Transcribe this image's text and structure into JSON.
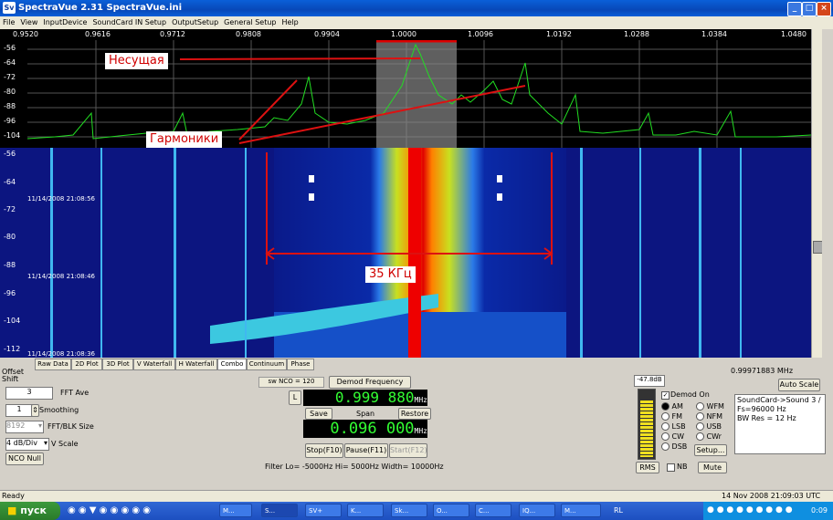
{
  "window": {
    "title": "SpectraVue 2.31 SpectraVue.ini",
    "app_icon": "Sv"
  },
  "menu": [
    "File",
    "View",
    "InputDevice",
    "SoundCard IN Setup",
    "OutputSetup",
    "General Setup",
    "Help"
  ],
  "freq_axis": [
    "0.9520",
    "0.9616",
    "0.9712",
    "0.9808",
    "0.9904",
    "1.0000",
    "1.0096",
    "1.0192",
    "1.0288",
    "1.0384",
    "1.0480"
  ],
  "spectrum_y": [
    "-56",
    "-64",
    "-72",
    "-80",
    "-88",
    "-96",
    "-104"
  ],
  "waterfall_y": [
    "-56",
    "-64",
    "-72",
    "-80",
    "-88",
    "-96",
    "-104",
    "-112"
  ],
  "timestamps": [
    "11/14/2008 21:08:56",
    "11/14/2008 21:08:46",
    "11/14/2008 21:08:36"
  ],
  "annotations": {
    "carrier": "Несущая",
    "harmonics": "Гармоники",
    "bandwidth": "35 КГц"
  },
  "tabs": [
    "Raw Data",
    "2D Plot",
    "3D Plot",
    "V Waterfall",
    "H Waterfall",
    "Combo",
    "Continuum",
    "Phase"
  ],
  "active_tab": "Combo",
  "left_panel": {
    "offset": "Offset",
    "shift": "Shift",
    "fft_ave_value": "3",
    "fft_ave_label": "FFT Ave",
    "smoothing_value": "1",
    "smoothing_label": "Smoothing",
    "fft_blk_value": "8192",
    "fft_blk_label": "FFT/BLK Size",
    "vscale_value": "4 dB/Div",
    "vscale_label": "V Scale",
    "nco_null": "NCO Null"
  },
  "center_panel": {
    "sw_nco": "sw NCO = 120",
    "demod_freq": "Demod Frequency",
    "l_btn": "L",
    "freq_value": "0.999 880",
    "freq_unit": "MHz",
    "save": "Save",
    "span": "Span",
    "restore": "Restore",
    "span_value": "0.096 000",
    "span_unit": "MHz",
    "stop": "Stop(F10)",
    "pause": "Pause(F11)",
    "start": "Start(F12)",
    "filter": "Filter  Lo= -5000Hz  Hi= 5000Hz  Width= 10000Hz"
  },
  "right_panel": {
    "db_value": "-47.8dB",
    "demod_on": "Demod On",
    "modes_left": [
      "AM",
      "FM",
      "LSB",
      "CW",
      "DSB"
    ],
    "modes_right": [
      "WFM",
      "NFM",
      "USB",
      "CWr"
    ],
    "selected_mode": "AM",
    "setup": "Setup...",
    "rms": "RMS",
    "nb": "NB",
    "mute": "Mute"
  },
  "info": {
    "mhz": "0.99971883 MHz",
    "auto_scale": "Auto Scale",
    "lines": [
      "SoundCard->Sound 3  /",
      "Fs=96000 Hz",
      "BW Res =   12 Hz"
    ]
  },
  "status": {
    "left": "Ready",
    "right": "14 Nov 2008  21:09:03 UTC"
  },
  "taskbar": {
    "start": "пуск",
    "items": [
      "M...",
      "S...",
      "SV+",
      "K...",
      "Sk...",
      "O...",
      "C...",
      "IQ...",
      "M..."
    ],
    "lang": "RL",
    "clock": "0:09"
  },
  "colors": {
    "titlebar": "#0a5fd8",
    "spectrum_trace": "#22dd22",
    "annotation_text": "#d00000",
    "annotation_line": "#dd1111",
    "led_text": "#33ff33"
  }
}
